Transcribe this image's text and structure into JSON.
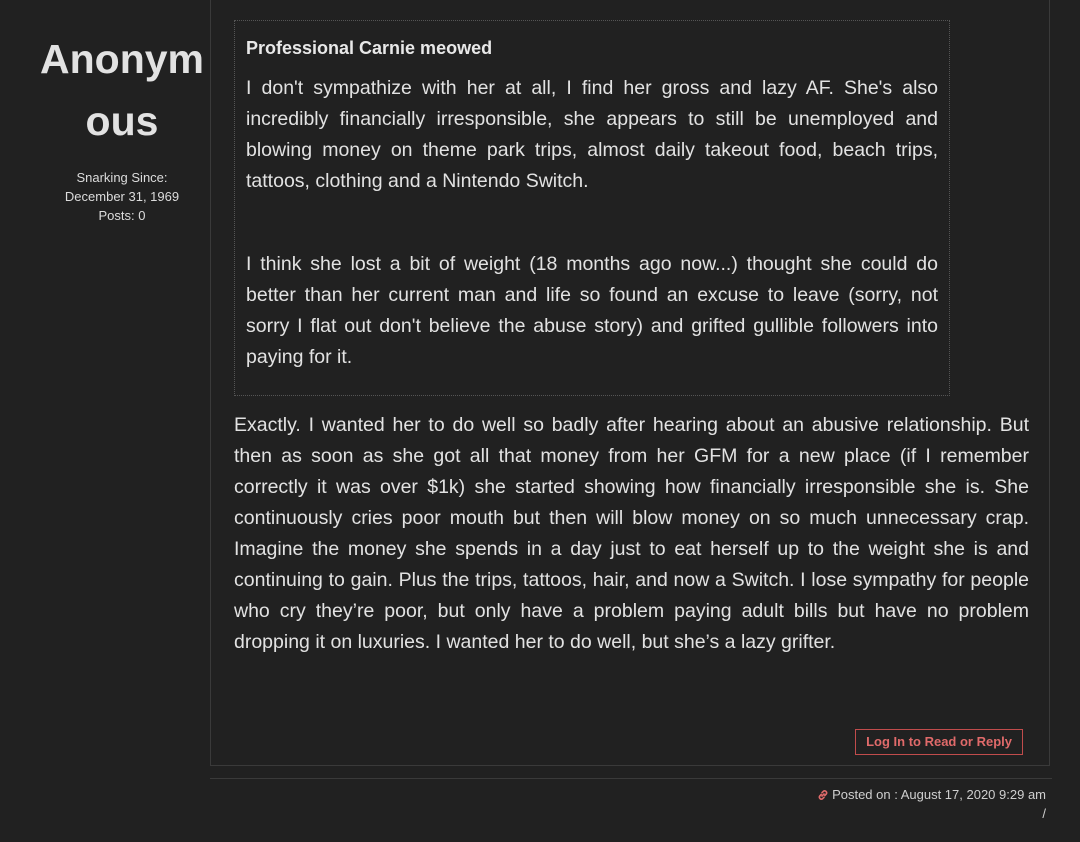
{
  "author": {
    "name": "Anonymous",
    "snarking_since_label": "Snarking Since:",
    "snarking_since_date": "December 31, 1969",
    "posts": "Posts: 0"
  },
  "quote": {
    "author": "Professional Carnie meowed",
    "paragraphs": [
      "I don't sympathize with her at all, I find her gross and lazy AF. She's also incredibly financially irresponsible, she appears to still be unemployed and blowing money on theme park trips, almost daily takeout food, beach trips, tattoos, clothing and a Nintendo Switch.",
      "I think she lost a bit of weight (18 months ago now...) thought she could do better than her current man and life so found an excuse to leave (sorry, not sorry I flat out don't believe the abuse story) and grifted gullible followers into paying for it."
    ]
  },
  "reply": {
    "body": "Exactly. I wanted her to do well so badly after hearing about an abusive relationship. But then as soon as she got all that money from her GFM for a new place (if I remember correctly it was over $1k) she started showing how financially irresponsible she is. She continuously cries poor mouth but then will blow money on so much unnecessary crap. Imagine the money she spends in a day just to eat herself up to the weight she is and continuing to gain. Plus the trips, tattoos, hair, and now a Switch. I lose sympathy for people who cry they’re poor, but only have a problem paying adult bills but have no problem dropping it on luxuries. I wanted her to do well, but she’s a lazy grifter."
  },
  "actions": {
    "login_reply_label": "Log In to Read or Reply"
  },
  "footer": {
    "posted_on": "Posted on : August 17, 2020 9:29 am",
    "separator": "/",
    "link_icon": "link-icon"
  },
  "colors": {
    "background": "#212121",
    "accent": "#e06a6a"
  }
}
